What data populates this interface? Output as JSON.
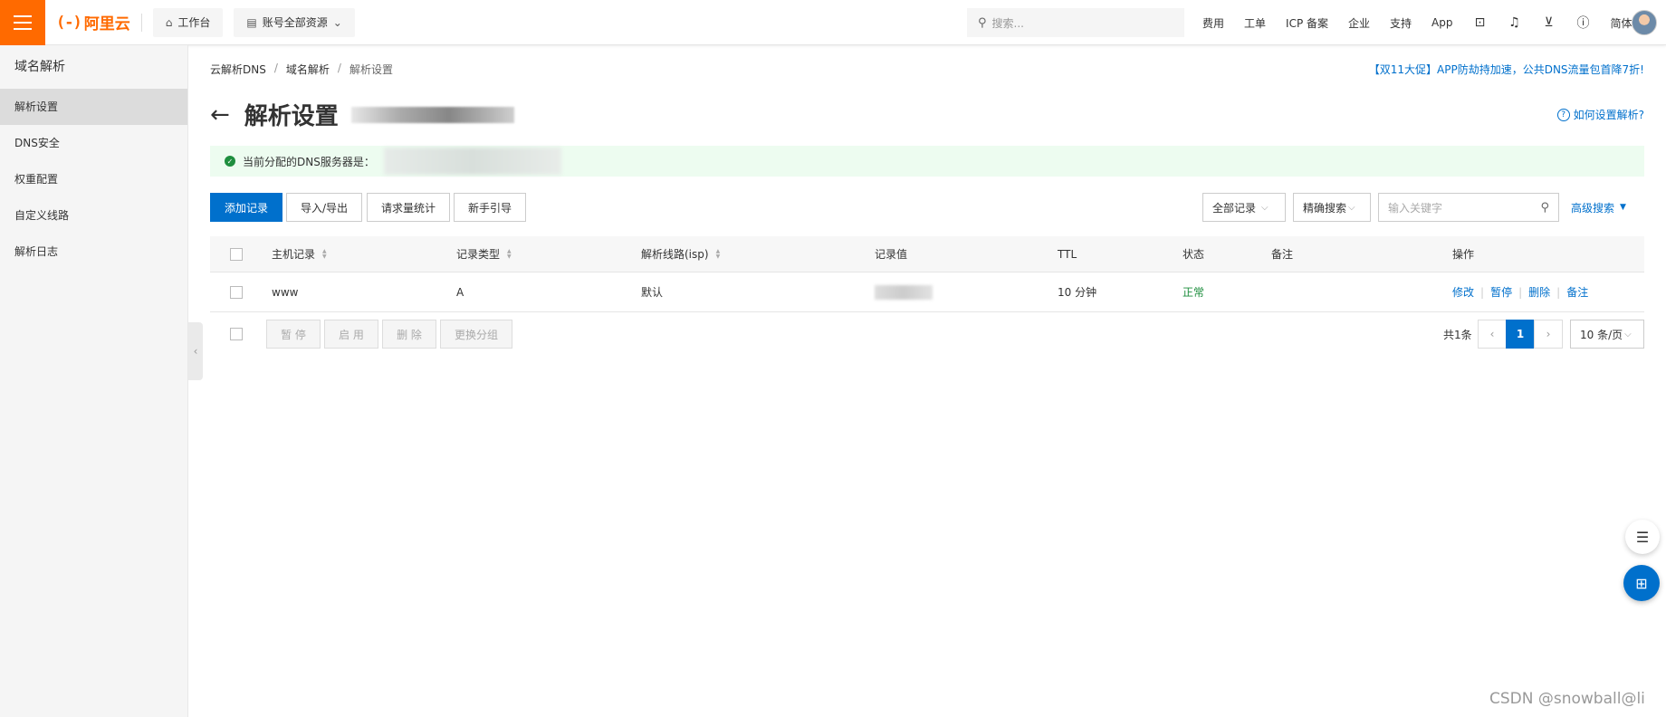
{
  "topbar": {
    "brand": "阿里云",
    "brand_mark": "(-)",
    "workbench": "工作台",
    "resources": "账号全部资源",
    "search_placeholder": "搜索...",
    "links": [
      "费用",
      "工单",
      "ICP 备案",
      "企业",
      "支持",
      "App"
    ],
    "lang": "简体",
    "accent": "#ff6a00"
  },
  "sidebar": {
    "header": "域名解析",
    "items": [
      {
        "label": "解析设置",
        "active": true
      },
      {
        "label": "DNS安全"
      },
      {
        "label": "权重配置"
      },
      {
        "label": "自定义线路"
      },
      {
        "label": "解析日志"
      }
    ]
  },
  "breadcrumb": [
    "云解析DNS",
    "域名解析",
    "解析设置"
  ],
  "promo": "【双11大促】APP防劫持加速，公共DNS流量包首降7折!",
  "page": {
    "title": "解析设置",
    "help": "如何设置解析?",
    "notice": "当前分配的DNS服务器是："
  },
  "toolbar": {
    "add": "添加记录",
    "import_export": "导入/导出",
    "stats": "请求量统计",
    "guide": "新手引导",
    "filter": "全部记录",
    "exact": "精确搜索",
    "keyword_placeholder": "输入关键字",
    "advanced": "高级搜索"
  },
  "table": {
    "headers": [
      "主机记录",
      "记录类型",
      "解析线路(isp)",
      "记录值",
      "TTL",
      "状态",
      "备注",
      "操作"
    ],
    "rows": [
      {
        "host": "www",
        "type": "A",
        "line": "默认",
        "value": "",
        "ttl": "10 分钟",
        "status": "正常",
        "remark": "",
        "ops": [
          "修改",
          "暂停",
          "删除",
          "备注"
        ]
      }
    ]
  },
  "bulk": {
    "pause": "暂 停",
    "enable": "启 用",
    "delete": "删 除",
    "group": "更换分组"
  },
  "pager": {
    "total": "共1条",
    "current": "1",
    "size": "10 条/页"
  },
  "watermark": "CSDN @snowball@li",
  "colors": {
    "link": "#0070cc",
    "success": "#1e8e3e"
  }
}
